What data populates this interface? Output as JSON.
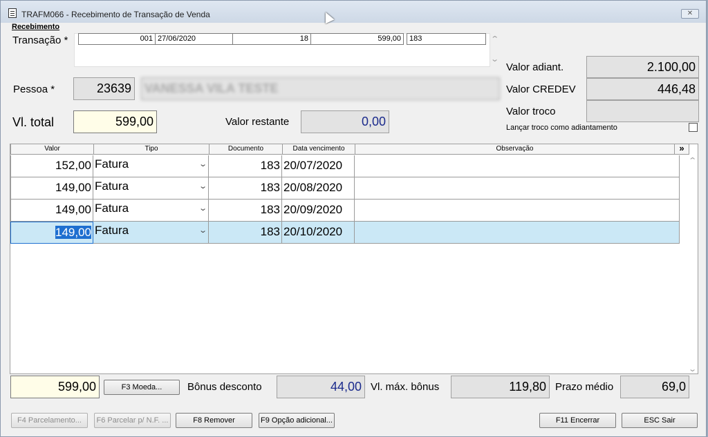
{
  "window": {
    "title": "TRAFM066 - Recebimento de Transação de Venda",
    "close_symbol": "✕"
  },
  "section": {
    "title": "Recebimento"
  },
  "transacao": {
    "label": "Transação *",
    "cells": [
      "001",
      "27/06/2020",
      "18",
      "599,00",
      "183"
    ]
  },
  "pessoa": {
    "label": "Pessoa *",
    "code": "23639",
    "name": "VANESSA VILA TESTE"
  },
  "valores": {
    "adiant_label": "Valor adiant.",
    "adiant_value": "2.100,00",
    "credev_label": "Valor CREDEV",
    "credev_value": "446,48",
    "troco_label": "Valor troco",
    "troco_value": "",
    "checkbox_label": "Lançar troco como adiantamento"
  },
  "totais": {
    "vl_total_label": "Vl. total",
    "vl_total_value": "599,00",
    "restante_label": "Valor restante",
    "restante_value": "0,00"
  },
  "grid": {
    "headers": [
      "Valor",
      "Tipo",
      "Documento",
      "Data vencimento",
      "Observação"
    ],
    "expand_label": "»",
    "rows": [
      {
        "valor": "152,00",
        "tipo": "Fatura",
        "documento": "183",
        "vencimento": "20/07/2020",
        "observacao": ""
      },
      {
        "valor": "149,00",
        "tipo": "Fatura",
        "documento": "183",
        "vencimento": "20/08/2020",
        "observacao": ""
      },
      {
        "valor": "149,00",
        "tipo": "Fatura",
        "documento": "183",
        "vencimento": "20/09/2020",
        "observacao": ""
      },
      {
        "valor": "149,00",
        "tipo": "Fatura",
        "documento": "183",
        "vencimento": "20/10/2020",
        "observacao": ""
      }
    ]
  },
  "footer": {
    "total": "599,00",
    "moeda_button": "F3 Moeda...",
    "bonus_label": "Bônus desconto",
    "bonus_value": "44,00",
    "max_bonus_label": "Vl. máx. bônus",
    "max_bonus_value": "119,80",
    "prazo_label": "Prazo médio",
    "prazo_value": "69,0"
  },
  "buttons": {
    "parcelamento": "F4 Parcelamento...",
    "parcelar_nf": "F6 Parcelar p/ N.F. ...",
    "remover": "F8 Remover",
    "opcao": "F9 Opção adicional...",
    "encerrar": "F11 Encerrar",
    "sair": "ESC Sair"
  }
}
